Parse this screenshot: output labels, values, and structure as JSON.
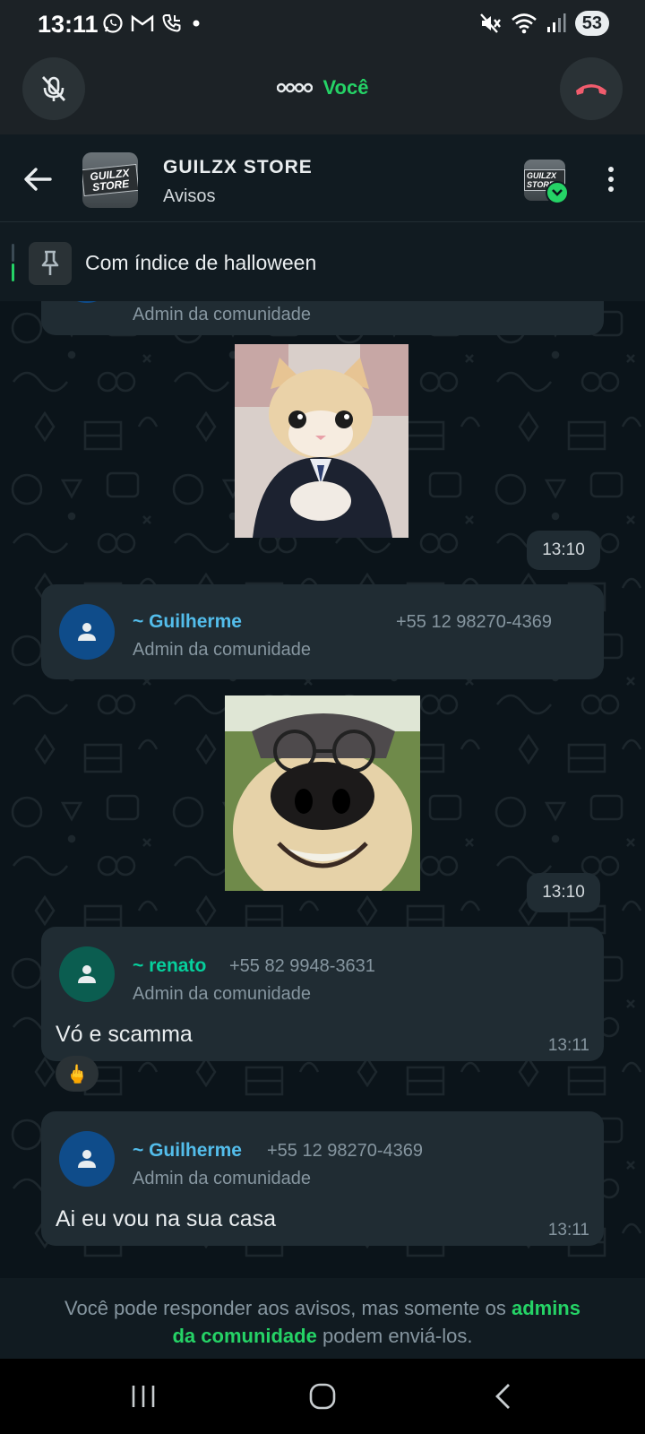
{
  "status_bar": {
    "time": "13:11",
    "battery": "53",
    "left_icons": [
      "whatsapp-icon",
      "gmail-icon",
      "phone-icon",
      "dot-icon"
    ],
    "right_icons": [
      "mute-icon",
      "wifi-icon",
      "signal-icon"
    ]
  },
  "call_bar": {
    "label": "Você",
    "mic_state": "muted"
  },
  "header": {
    "title": "GUILZX STORE",
    "subtitle": "Avisos",
    "avatar_text": "GUILZX STORE",
    "avatar_text_small": "GUILZX STORE"
  },
  "pinned": {
    "text": "Com índice de halloween"
  },
  "messages": [
    {
      "role": "Admin da comunidade"
    },
    {
      "time": "13:10",
      "sticker": "kitten-in-suit-sticker"
    },
    {
      "sender": "~ Guilherme",
      "phone": "+55 12 98270-4369",
      "role": "Admin da comunidade"
    },
    {
      "time": "13:10",
      "sticker": "dog-with-glasses-sticker"
    },
    {
      "sender": "~ renato",
      "phone": "+55 82 9948-3631",
      "role": "Admin da comunidade",
      "text": "Vó e scamma",
      "time": "13:11",
      "reaction": "🖕"
    },
    {
      "sender": "~ Guilherme",
      "phone": "+55 12 98270-4369",
      "role": "Admin da comunidade",
      "text": "Ai eu vou na sua casa",
      "time": "13:11"
    }
  ],
  "footer": {
    "part1": "Você pode responder aos avisos, mas somente os ",
    "link1": "admins",
    "link2": "da comunidade",
    "part2": " podem enviá-los."
  },
  "colors": {
    "accent": "#25d366",
    "guilherme_name": "#53bdeb",
    "renato_name": "#06cf9c",
    "bubble": "#202c33",
    "background": "#0b141a"
  }
}
